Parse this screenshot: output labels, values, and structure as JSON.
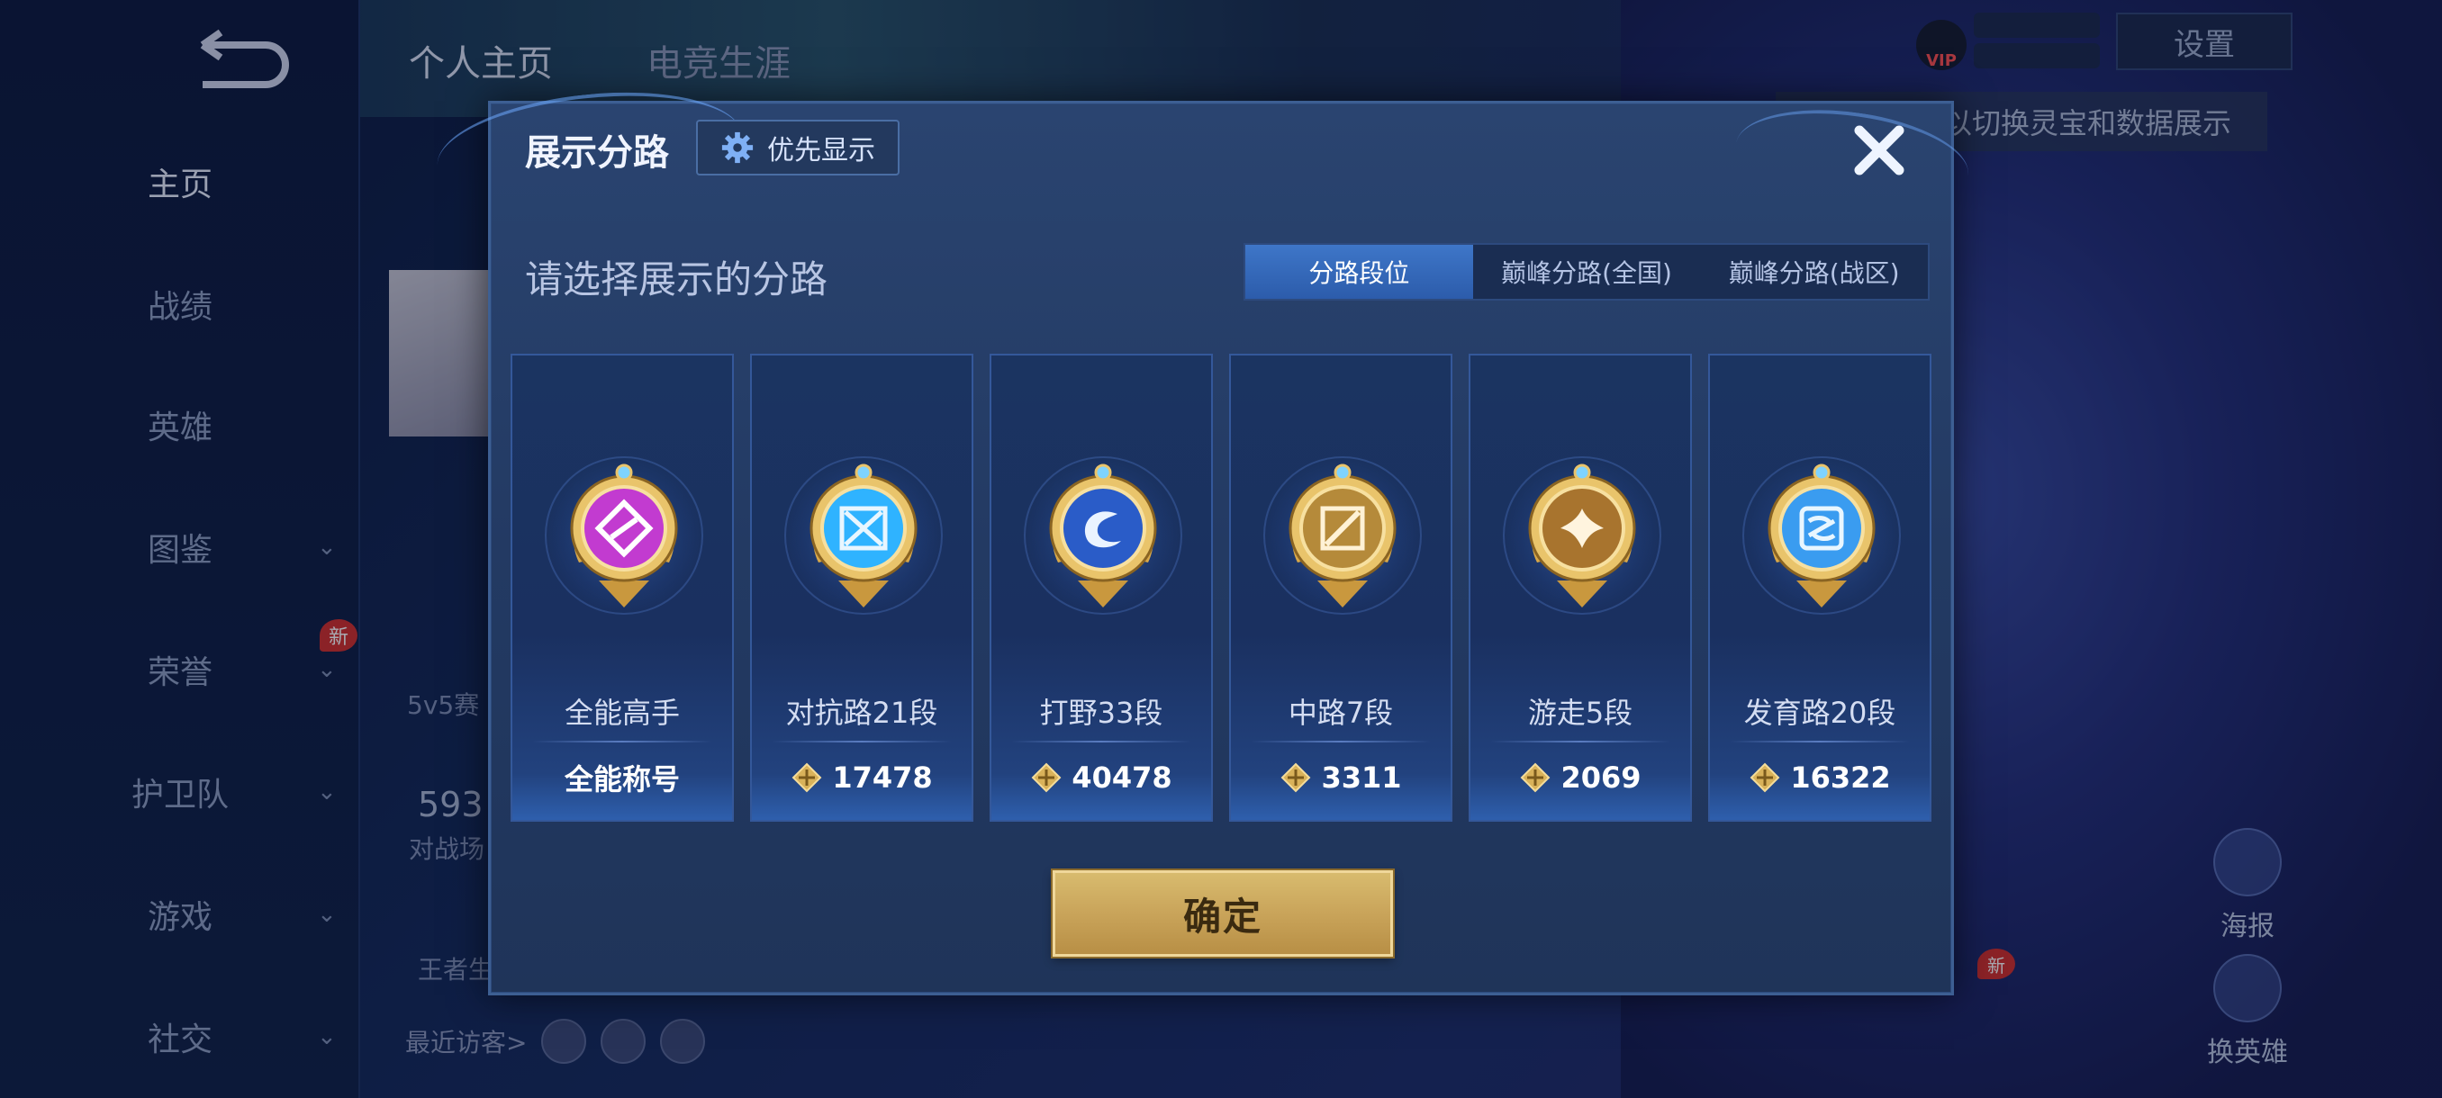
{
  "background": {
    "top_tabs": [
      "个人主页",
      "电竞生涯"
    ],
    "sidebar": {
      "items": [
        {
          "label": "主页",
          "active": true,
          "chevron": false
        },
        {
          "label": "战绩",
          "chevron": false
        },
        {
          "label": "英雄",
          "chevron": false
        },
        {
          "label": "图鉴",
          "chevron": true
        },
        {
          "label": "荣誉",
          "chevron": true,
          "badge": "新"
        },
        {
          "label": "护卫队",
          "chevron": true
        },
        {
          "label": "游戏",
          "chevron": true
        },
        {
          "label": "社交",
          "chevron": true
        }
      ]
    },
    "settings_label": "设置",
    "vip_label": "VIP",
    "tip_text": "以切换灵宝和数据展示",
    "right_buttons": [
      {
        "label": "海报"
      },
      {
        "label": "换英雄"
      }
    ],
    "right_new_badge": "新",
    "left_stats": {
      "mode": "5v5赛",
      "value": "593",
      "sub": "对战场",
      "honor": "王者生"
    },
    "recent_visitors_label": "最近访客>"
  },
  "modal": {
    "title": "展示分路",
    "priority_label": "优先显示",
    "subtitle": "请选择展示的分路",
    "tabs": [
      {
        "label": "分路段位",
        "active": true
      },
      {
        "label": "巅峰分路(全国)",
        "active": false
      },
      {
        "label": "巅峰分路(战区)",
        "active": false
      }
    ],
    "cards": [
      {
        "lane": "全能高手",
        "value": "全能称号",
        "has_diamond": false,
        "emblem": "all-round-emblem-icon",
        "color": "#c23bd0"
      },
      {
        "lane": "对抗路21段",
        "value": "17478",
        "has_diamond": true,
        "emblem": "clash-lane-emblem-icon",
        "color": "#2fb3ff"
      },
      {
        "lane": "打野33段",
        "value": "40478",
        "has_diamond": true,
        "emblem": "jungle-emblem-icon",
        "color": "#2a5cc8"
      },
      {
        "lane": "中路7段",
        "value": "3311",
        "has_diamond": true,
        "emblem": "mid-lane-emblem-icon",
        "color": "#b58a3a"
      },
      {
        "lane": "游走5段",
        "value": "2069",
        "has_diamond": true,
        "emblem": "roam-emblem-icon",
        "color": "#a8742e"
      },
      {
        "lane": "发育路20段",
        "value": "16322",
        "has_diamond": true,
        "emblem": "farm-lane-emblem-icon",
        "color": "#3a9cf0"
      }
    ],
    "confirm_label": "确定"
  }
}
